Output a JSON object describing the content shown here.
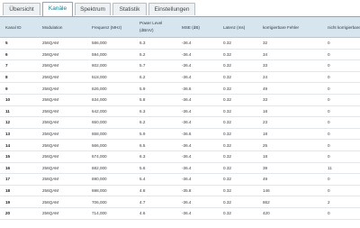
{
  "tabs": [
    {
      "label": "Übersicht",
      "active": false
    },
    {
      "label": "Kanäle",
      "active": true
    },
    {
      "label": "Spektrum",
      "active": false
    },
    {
      "label": "Statistik",
      "active": false
    },
    {
      "label": "Einstellungen",
      "active": false
    }
  ],
  "table": {
    "headers": {
      "kanal_id": "Kanal ID",
      "modulation": "Modulation",
      "frequenz": "Frequenz (MHz)",
      "power_level": "Power Level",
      "power_unit": "(dBmV)",
      "mse": "MSE (dB)",
      "latenz": "Latenz (ms)",
      "korrigierbar": "korrigierbare Fehler",
      "nicht_korrigierbar": "nicht korrigierbare Fehler"
    },
    "rows": [
      {
        "id": "5",
        "mod": "256QAM",
        "freq": "586,000",
        "power": "6.3",
        "mse": "-36.4",
        "lat": "0.32",
        "korr": "32",
        "nkorr": "0"
      },
      {
        "id": "6",
        "mod": "256QAM",
        "freq": "594,000",
        "power": "6.2",
        "mse": "-36.4",
        "lat": "0.32",
        "korr": "34",
        "nkorr": "0"
      },
      {
        "id": "7",
        "mod": "256QAM",
        "freq": "602,000",
        "power": "5.7",
        "mse": "-36.4",
        "lat": "0.32",
        "korr": "33",
        "nkorr": "0"
      },
      {
        "id": "8",
        "mod": "256QAM",
        "freq": "618,000",
        "power": "6.2",
        "mse": "-36.4",
        "lat": "0.32",
        "korr": "24",
        "nkorr": "0"
      },
      {
        "id": "9",
        "mod": "256QAM",
        "freq": "626,000",
        "power": "5.9",
        "mse": "-36.6",
        "lat": "0.32",
        "korr": "49",
        "nkorr": "0"
      },
      {
        "id": "10",
        "mod": "256QAM",
        "freq": "634,000",
        "power": "5.8",
        "mse": "-36.4",
        "lat": "0.32",
        "korr": "33",
        "nkorr": "0"
      },
      {
        "id": "11",
        "mod": "256QAM",
        "freq": "642,000",
        "power": "6.3",
        "mse": "-36.4",
        "lat": "0.32",
        "korr": "18",
        "nkorr": "0"
      },
      {
        "id": "12",
        "mod": "256QAM",
        "freq": "650,000",
        "power": "6.2",
        "mse": "-36.4",
        "lat": "0.32",
        "korr": "23",
        "nkorr": "0"
      },
      {
        "id": "13",
        "mod": "256QAM",
        "freq": "658,000",
        "power": "5.9",
        "mse": "-36.6",
        "lat": "0.32",
        "korr": "18",
        "nkorr": "0"
      },
      {
        "id": "14",
        "mod": "256QAM",
        "freq": "666,000",
        "power": "6.5",
        "mse": "-36.4",
        "lat": "0.32",
        "korr": "25",
        "nkorr": "0"
      },
      {
        "id": "15",
        "mod": "256QAM",
        "freq": "674,000",
        "power": "6.3",
        "mse": "-36.4",
        "lat": "0.32",
        "korr": "18",
        "nkorr": "0"
      },
      {
        "id": "16",
        "mod": "256QAM",
        "freq": "682,000",
        "power": "5.6",
        "mse": "-36.4",
        "lat": "0.32",
        "korr": "39",
        "nkorr": "11"
      },
      {
        "id": "17",
        "mod": "256QAM",
        "freq": "690,000",
        "power": "5.4",
        "mse": "-36.4",
        "lat": "0.32",
        "korr": "49",
        "nkorr": "0"
      },
      {
        "id": "18",
        "mod": "256QAM",
        "freq": "698,000",
        "power": "4.8",
        "mse": "-35.8",
        "lat": "0.32",
        "korr": "146",
        "nkorr": "0"
      },
      {
        "id": "19",
        "mod": "256QAM",
        "freq": "706,000",
        "power": "4.7",
        "mse": "-36.4",
        "lat": "0.32",
        "korr": "862",
        "nkorr": "2"
      },
      {
        "id": "20",
        "mod": "256QAM",
        "freq": "714,000",
        "power": "4.6",
        "mse": "-36.4",
        "lat": "0.32",
        "korr": "420",
        "nkorr": "0"
      }
    ]
  }
}
